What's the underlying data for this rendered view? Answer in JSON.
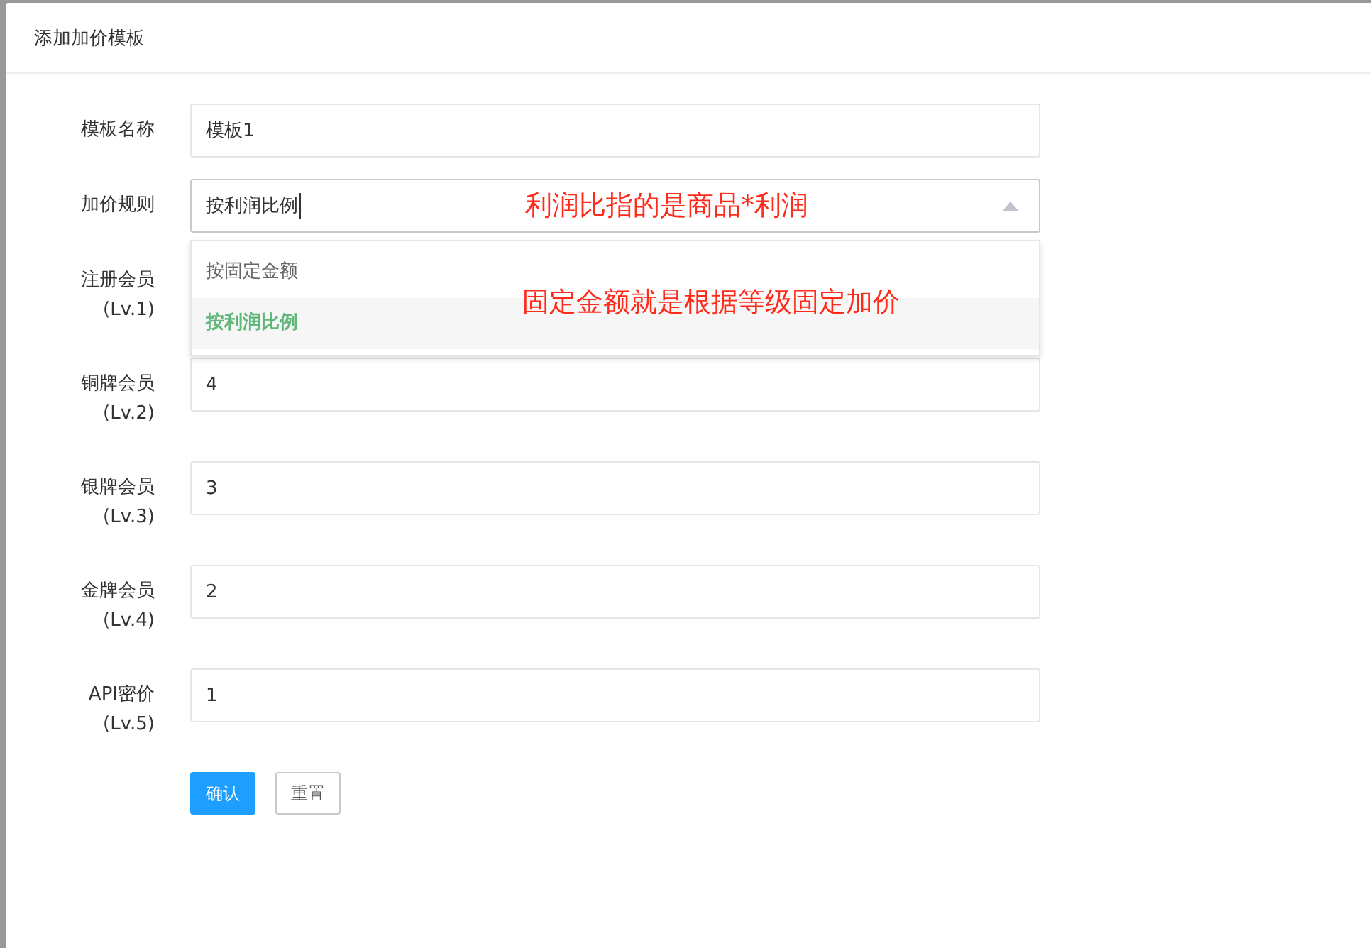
{
  "dialog": {
    "title": "添加加价模板"
  },
  "form": {
    "name": {
      "label": "模板名称",
      "value": "模板1"
    },
    "rule": {
      "label": "加价规则",
      "value": "按利润比例",
      "expanded": true,
      "options": [
        {
          "label": "按固定金额",
          "selected": false
        },
        {
          "label": "按利润比例",
          "selected": true
        }
      ]
    },
    "levels": [
      {
        "label": "注册会员",
        "level_tag": "(Lv.1)"
      },
      {
        "label": "铜牌会员",
        "level_tag": "(Lv.2)",
        "value": "4"
      },
      {
        "label": "银牌会员",
        "level_tag": "(Lv.3)",
        "value": "3"
      },
      {
        "label": "金牌会员",
        "level_tag": "(Lv.4)",
        "value": "2"
      },
      {
        "label": "API密价",
        "level_tag": "(Lv.5)",
        "value": "1"
      }
    ],
    "buttons": [
      {
        "label": "确认",
        "kind": "primary"
      },
      {
        "label": "重置",
        "kind": "default"
      }
    ]
  },
  "annotations": [
    "利润比指的是商品*利润",
    "固定金额就是根据等级固定加价"
  ]
}
